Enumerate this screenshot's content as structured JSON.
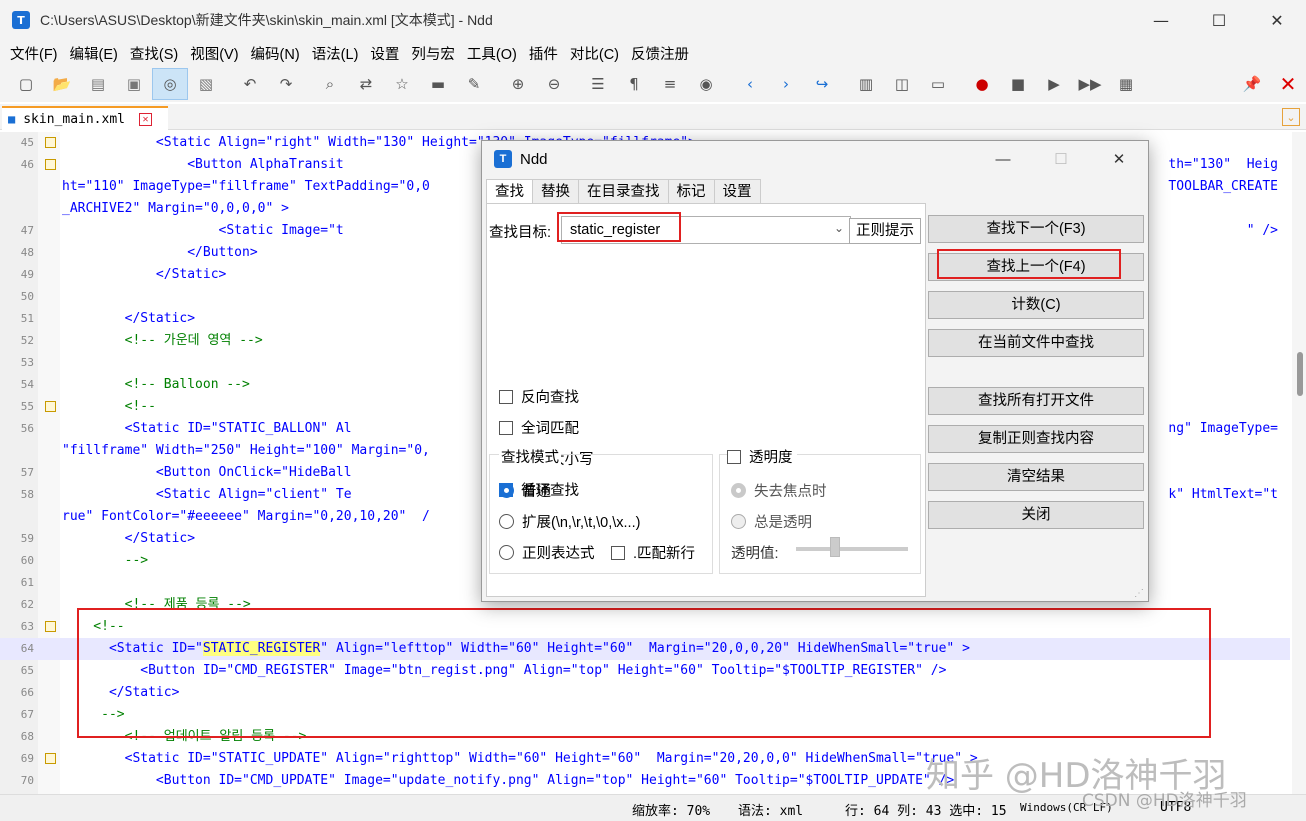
{
  "window": {
    "title": "C:\\Users\\ASUS\\Desktop\\新建文件夹\\skin\\skin_main.xml [文本模式] - Ndd",
    "app_icon_letter": "T"
  },
  "menu": [
    "文件(F)",
    "编辑(E)",
    "查找(S)",
    "视图(V)",
    "编码(N)",
    "语法(L)",
    "设置",
    "列与宏",
    "工具(O)",
    "插件",
    "对比(C)",
    "反馈注册"
  ],
  "toolbar_icons": [
    "new-file-icon",
    "open-folder-icon",
    "save-icon",
    "save-all-icon",
    "wrap-icon",
    "close-file-icon",
    "undo-icon",
    "redo-icon",
    "find-icon",
    "replace-icon",
    "bookmark-icon",
    "highlight-icon",
    "erase-icon",
    "zoom-in-icon",
    "zoom-out-icon",
    "format-icon",
    "paragraph-icon",
    "indent-icon",
    "target-icon",
    "prev-icon",
    "next-icon",
    "goto-icon",
    "compare-icon",
    "split-icon",
    "monitor-icon",
    "record-icon",
    "stop-icon",
    "play-icon",
    "fast-play-icon",
    "save-macro-icon"
  ],
  "file_tab": {
    "name": "skin_main.xml"
  },
  "editor": {
    "lines": [
      {
        "n": "45",
        "text": "            <Static Align=\"right\" Width=\"130\" Height=\"130\" ImageType=\"fillframe\">",
        "fold": true
      },
      {
        "n": "46",
        "text": "                <Button AlphaTransit",
        "tail": "th=\"130\"  Heig",
        "fold": true
      },
      {
        "n": "",
        "text": "ht=\"110\" ImageType=\"fillframe\" TextPadding=\"0,0",
        "tail": "TOOLBAR_CREATE",
        "wrap": true
      },
      {
        "n": "",
        "text": "_ARCHIVE2\" Margin=\"0,0,0,0\" >",
        "wrap": true
      },
      {
        "n": "47",
        "text": "                    <Static Image=\"t",
        "tail": "\" />"
      },
      {
        "n": "48",
        "text": "                </Button>"
      },
      {
        "n": "49",
        "text": "            </Static>"
      },
      {
        "n": "50",
        "text": ""
      },
      {
        "n": "51",
        "text": "        </Static>"
      },
      {
        "n": "52",
        "text": "        <!-- 가운데 영역 -->",
        "comment": true
      },
      {
        "n": "53",
        "text": ""
      },
      {
        "n": "54",
        "text": "        <!-- Balloon -->",
        "comment": true
      },
      {
        "n": "55",
        "text": "        <!--",
        "comment": true,
        "fold": true
      },
      {
        "n": "56",
        "text": "        <Static ID=\"STATIC_BALLON\" Al",
        "tail": "ng\" ImageType="
      },
      {
        "n": "",
        "text": "\"fillframe\" Width=\"250\" Height=\"100\" Margin=\"0,",
        "wrap": true
      },
      {
        "n": "57",
        "text": "            <Button OnClick=\"HideBall"
      },
      {
        "n": "58",
        "text": "            <Static Align=\"client\" Te",
        "tail": "k\" HtmlText=\"t"
      },
      {
        "n": "",
        "text": "rue\" FontColor=\"#eeeeee\" Margin=\"0,20,10,20\"  /",
        "wrap": true
      },
      {
        "n": "59",
        "text": "        </Static>"
      },
      {
        "n": "60",
        "text": "        -->",
        "comment": true
      },
      {
        "n": "61",
        "text": ""
      },
      {
        "n": "62",
        "text": "        <!-- 제품 등록 -->",
        "comment": true
      },
      {
        "n": "63",
        "text": "    <!--",
        "comment": true,
        "fold": true
      },
      {
        "n": "64",
        "pre": "      <Static ID=\"",
        "word": "STATIC_REGISTER",
        "post": "\" Align=\"lefttop\" Width=\"60\" Height=\"60\"  Margin=\"20,0,0,20\" HideWhenSmall=\"true\" >",
        "highlight": true
      },
      {
        "n": "65",
        "text": "          <Button ID=\"CMD_REGISTER\" Image=\"btn_regist.png\" Align=\"top\" Height=\"60\" Tooltip=\"$TOOLTIP_REGISTER\" />"
      },
      {
        "n": "66",
        "text": "      </Static>"
      },
      {
        "n": "67",
        "text": "     -->",
        "comment": true
      },
      {
        "n": "68",
        "text": "        <!-- 업데이트 알림 등록 -->",
        "comment": true
      },
      {
        "n": "69",
        "text": "        <Static ID=\"STATIC_UPDATE\" Align=\"righttop\" Width=\"60\" Height=\"60\"  Margin=\"20,20,0,0\" HideWhenSmall=\"true\" >",
        "fold": true
      },
      {
        "n": "70",
        "text": "            <Button ID=\"CMD_UPDATE\" Image=\"update_notify.png\" Align=\"top\" Height=\"60\" Tooltip=\"$TOOLTIP_UPDATE\" />"
      }
    ]
  },
  "status": {
    "zoom": "缩放率: 70%",
    "syntax": "语法: xml",
    "position": "行: 64 列: 43 选中: 15",
    "eol": "Windows(CR LF)",
    "encoding": "UTF8"
  },
  "watermark": {
    "big": "知乎 @HD洛神千羽",
    "small": "CSDN @HD洛神千羽"
  },
  "dialog": {
    "title": "Ndd",
    "tabs": [
      "查找",
      "替换",
      "在目录查找",
      "标记",
      "设置"
    ],
    "active_tab": 0,
    "search_label": "查找目标:",
    "search_value": "static_register",
    "regex_hint": "正则提示",
    "options": [
      {
        "label": "反向查找",
        "checked": false
      },
      {
        "label": "全词匹配",
        "checked": false
      },
      {
        "label": "匹配大小写",
        "checked": false
      },
      {
        "label": "循环查找",
        "checked": true
      }
    ],
    "mode_title": "查找模式",
    "modes": [
      {
        "label": "普通",
        "selected": true
      },
      {
        "label": "扩展(\\n,\\r,\\t,\\0,\\x...)",
        "selected": false
      },
      {
        "label": "正则表达式",
        "selected": false
      }
    ],
    "dot_newline": ".匹配新行",
    "transparency_title": "透明度",
    "transparency_modes": [
      {
        "label": "失去焦点时",
        "selected": true
      },
      {
        "label": "总是透明",
        "selected": false
      }
    ],
    "transparency_value_label": "透明值:",
    "buttons": [
      "查找下一个(F3)",
      "查找上一个(F4)",
      "计数(C)",
      "在当前文件中查找",
      "查找所有打开文件",
      "复制正则查找内容",
      "清空结果",
      "关闭"
    ]
  },
  "colors": {
    "accent": "#1a6fd4",
    "highlight_box": "#e02020",
    "comment": "#008000",
    "tag": "#0000ff"
  }
}
